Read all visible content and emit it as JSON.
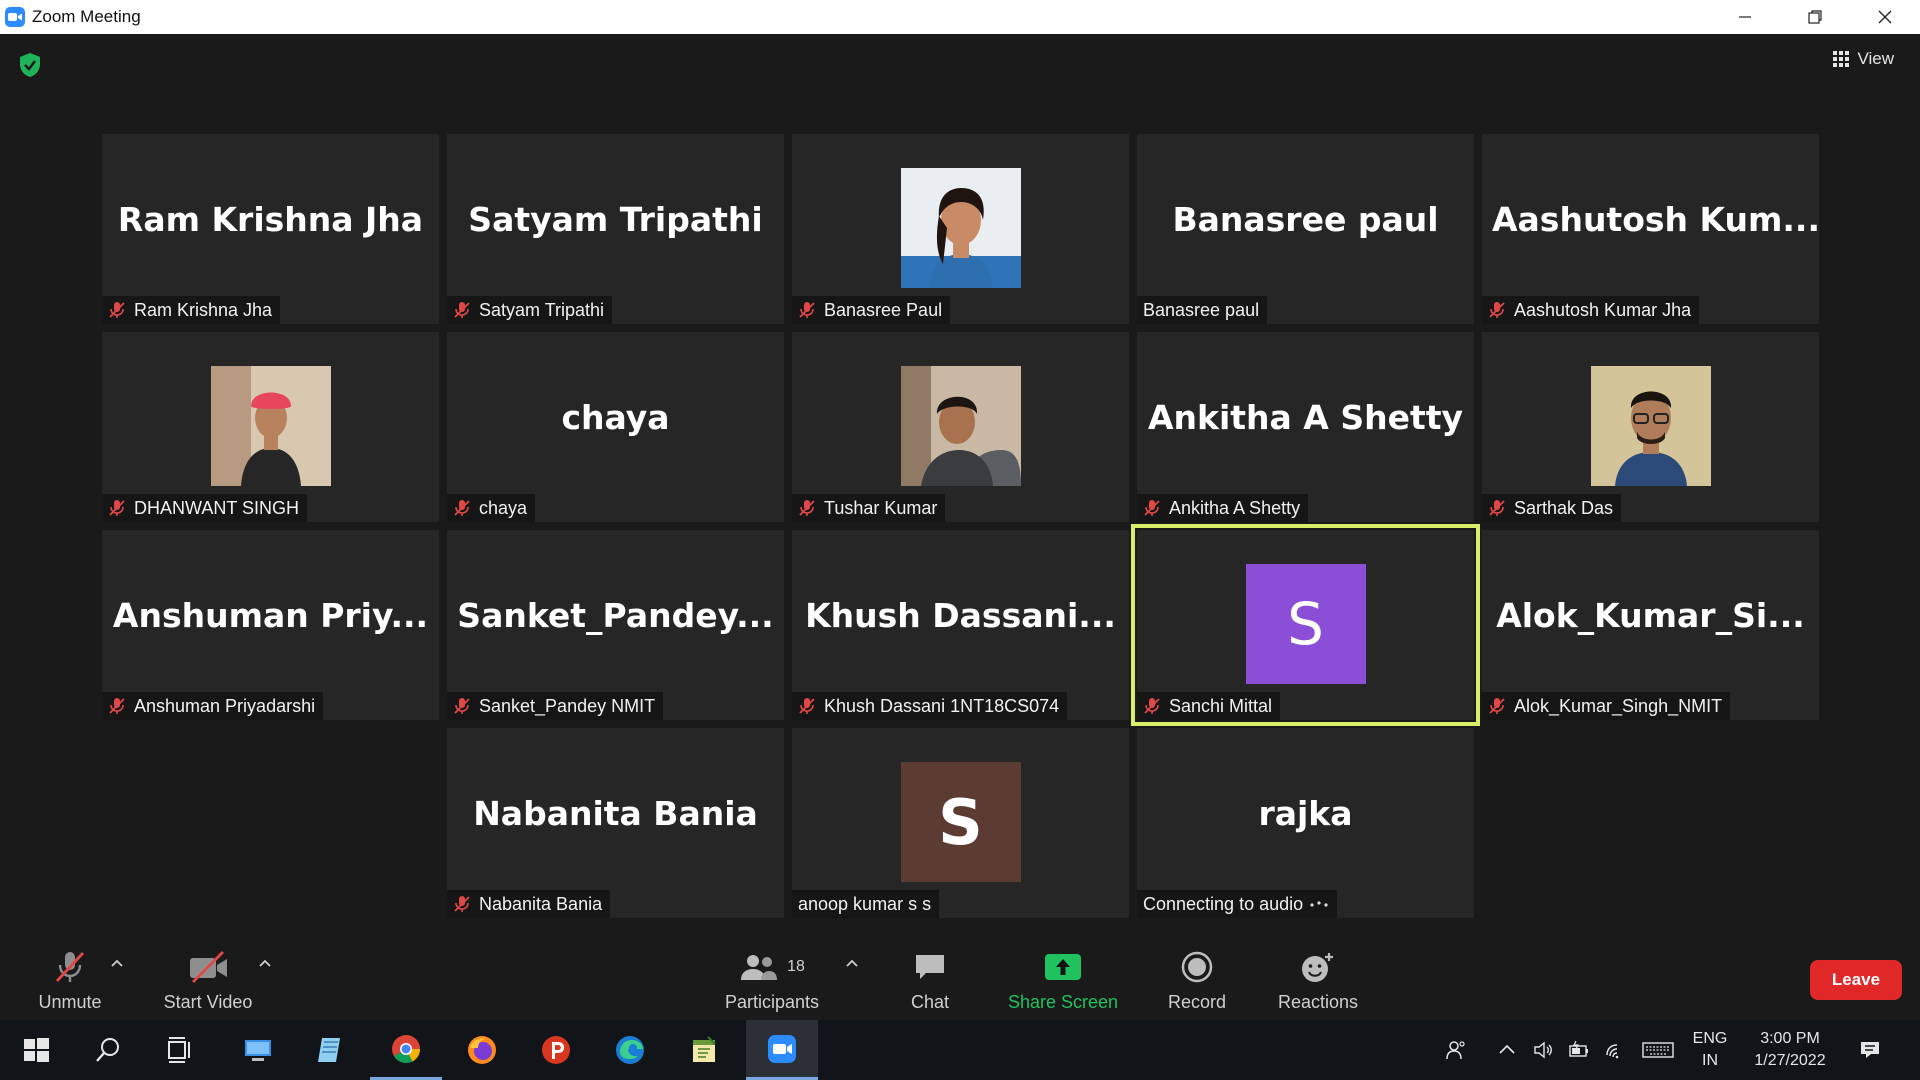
{
  "window": {
    "title": "Zoom Meeting"
  },
  "header": {
    "view_label": "View"
  },
  "participants": [
    {
      "big_name": "Ram Krishna Jha",
      "label": "Ram Krishna Jha",
      "muted": true
    },
    {
      "big_name": "Satyam Tripathi",
      "label": "Satyam Tripathi",
      "muted": true
    },
    {
      "big_name": "",
      "label": "Banasree Paul",
      "muted": true
    },
    {
      "big_name": "Banasree paul",
      "label": "Banasree paul",
      "muted": false
    },
    {
      "big_name": "Aashutosh  Kum...",
      "label": "Aashutosh Kumar Jha",
      "muted": true
    },
    {
      "big_name": "",
      "label": "DHANWANT SINGH",
      "muted": true
    },
    {
      "big_name": "chaya",
      "label": "chaya",
      "muted": true
    },
    {
      "big_name": "",
      "label": "Tushar Kumar",
      "muted": true
    },
    {
      "big_name": "Ankitha A Shetty",
      "label": "Ankitha A Shetty",
      "muted": true
    },
    {
      "big_name": "",
      "label": "Sarthak Das",
      "muted": true
    },
    {
      "big_name": "Anshuman  Priy...",
      "label": "Anshuman Priyadarshi",
      "muted": true
    },
    {
      "big_name": "Sanket_Pandey...",
      "label": "Sanket_Pandey NMIT",
      "muted": true
    },
    {
      "big_name": "Khush  Dassani...",
      "label": "Khush Dassani 1NT18CS074",
      "muted": true
    },
    {
      "big_name": "",
      "avatar_letter": "S",
      "avatar_color": "#8a4fd6",
      "label": "Sanchi Mittal",
      "muted": true,
      "active_speaker": true
    },
    {
      "big_name": "Alok_Kumar_Si...",
      "label": "Alok_Kumar_Singh_NMIT",
      "muted": true
    },
    {
      "big_name": "Nabanita Bania",
      "label": "Nabanita Bania",
      "muted": true
    },
    {
      "big_name": "",
      "avatar_letter": "S",
      "avatar_color": "#5c3b33",
      "label": "anoop kumar s s",
      "muted": false
    },
    {
      "big_name": "rajka",
      "label": "Connecting to audio",
      "muted": false
    }
  ],
  "toolbar": {
    "unmute_label": "Unmute",
    "start_video_label": "Start Video",
    "participants_label": "Participants",
    "participants_count": "18",
    "chat_label": "Chat",
    "share_screen_label": "Share Screen",
    "record_label": "Record",
    "reactions_label": "Reactions",
    "leave_label": "Leave"
  },
  "taskbar": {
    "language_line1": "ENG",
    "language_line2": "IN",
    "time": "3:00 PM",
    "date": "1/27/2022"
  },
  "colors": {
    "active_speaker_outline": "#d9ef6a",
    "share_screen": "#1fc25e",
    "leave": "#e02828",
    "mute_icon": "#e04848"
  }
}
